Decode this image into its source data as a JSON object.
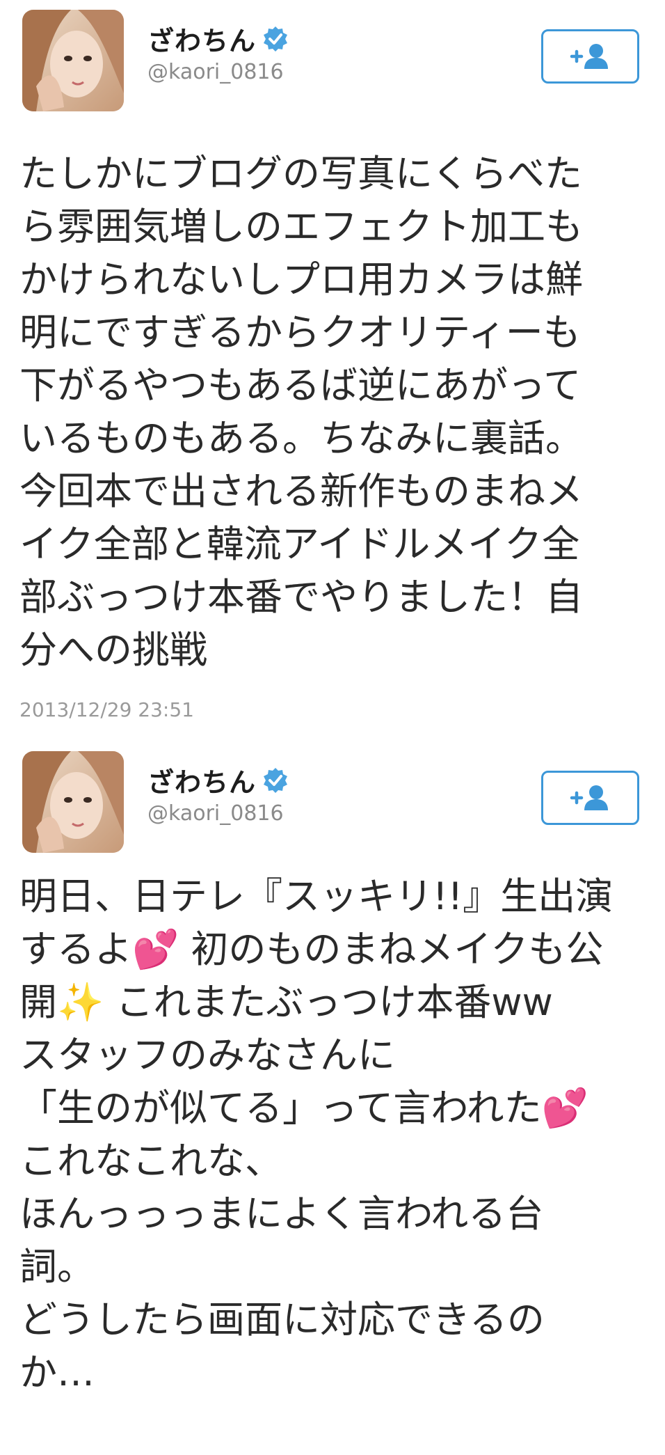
{
  "tweets": [
    {
      "display_name": "ざわちん",
      "handle": "@kaori_0816",
      "follow_icon": "add-user-icon",
      "verified_icon": "verified-badge-icon",
      "text": "たしかにブログの写真にくらべた\nら雰囲気増しのエフェクト加工も\nかけられないしプロ用カメラは鮮\n明にですぎるからクオリティーも\n下がるやつもあるば逆にあがって\nいるものもある。ちなみに裏話。\n今回本で出される新作ものまねメ\nイク全部と韓流アイドルメイク全\n部ぶっつけ本番でやりました！自\n分への挑戦",
      "timestamp": "2013/12/29 23:51"
    },
    {
      "display_name": "ざわちん",
      "handle": "@kaori_0816",
      "follow_icon": "add-user-icon",
      "verified_icon": "verified-badge-icon",
      "text": "明日、日テレ『スッキリ!!』生出演\nするよ💕 初のものまねメイクも公\n開✨ これまたぶっつけ本番ww\nスタッフのみなさんに\n「生のが似てる」って言われた💕\nこれなこれな、\nほんっっっまによく言われる台\n詞。\nどうしたら画面に対応できるの\nか…"
    }
  ],
  "colors": {
    "accent": "#3c97d8",
    "handle": "#8a8a8a",
    "text": "#2a2a2a",
    "timestamp": "#9a9a9a"
  }
}
